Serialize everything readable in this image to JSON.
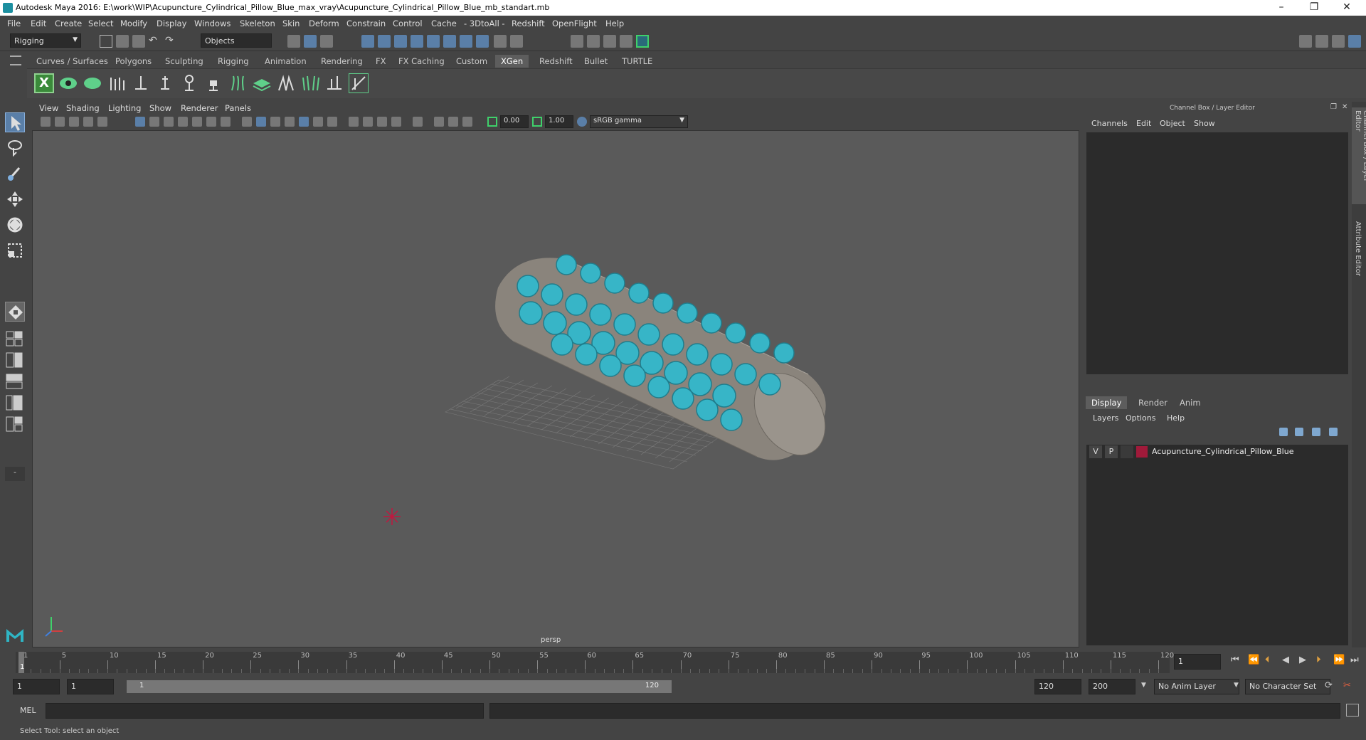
{
  "window": {
    "title": "Autodesk Maya 2016: E:\\work\\WIP\\Acupuncture_Cylindrical_Pillow_Blue_max_vray\\Acupuncture_Cylindrical_Pillow_Blue_mb_standart.mb",
    "minimize": "–",
    "restore": "❐",
    "close": "✕"
  },
  "menubar": [
    "File",
    "Edit",
    "Create",
    "Select",
    "Modify",
    "Display",
    "Windows",
    "Skeleton",
    "Skin",
    "Deform",
    "Constrain",
    "Control",
    "Cache",
    "- 3DtoAll -",
    "Redshift",
    "OpenFlight",
    "Help"
  ],
  "statusline": {
    "mode": "Rigging",
    "selection_mode": "Objects"
  },
  "shelf_tabs": [
    "Curves / Surfaces",
    "Polygons",
    "Sculpting",
    "Rigging",
    "Animation",
    "Rendering",
    "FX",
    "FX Caching",
    "Custom",
    "XGen",
    "Redshift",
    "Bullet",
    "TURTLE"
  ],
  "active_shelf_tab": "XGen",
  "panel_menu": [
    "View",
    "Shading",
    "Lighting",
    "Show",
    "Renderer",
    "Panels"
  ],
  "panel_toolbar": {
    "exposure": "0.00",
    "gamma": "1.00",
    "colorspace": "sRGB gamma"
  },
  "viewport": {
    "camera_label": "persp"
  },
  "channel_box": {
    "title": "Channel Box / Layer Editor",
    "menus": [
      "Channels",
      "Edit",
      "Object",
      "Show"
    ]
  },
  "layer_editor": {
    "tabs": [
      "Display",
      "Render",
      "Anim"
    ],
    "active_tab": "Display",
    "menus": [
      "Layers",
      "Options",
      "Help"
    ],
    "layers": [
      {
        "v": "V",
        "p": "P",
        "name": "Acupuncture_Cylindrical_Pillow_Blue",
        "color": "#a01a3a"
      }
    ]
  },
  "side_tabs": [
    "Channel Box / Layer Editor",
    "Attribute Editor"
  ],
  "timeline": {
    "ticks": [
      "1",
      "5",
      "10",
      "15",
      "20",
      "25",
      "30",
      "35",
      "40",
      "45",
      "50",
      "55",
      "60",
      "65",
      "70",
      "75",
      "80",
      "85",
      "90",
      "95",
      "100",
      "105",
      "110",
      "115",
      "120"
    ],
    "current_frame": "1"
  },
  "range": {
    "start": "1",
    "anim_start": "1",
    "range_slider_start": "1",
    "range_slider_end": "120",
    "anim_end_field": "120",
    "end": "200",
    "anim_layer": "No Anim Layer",
    "char_set": "No Character Set"
  },
  "cmdline": {
    "label": "MEL"
  },
  "helpline": {
    "text": "Select Tool: select an object"
  },
  "colors": {
    "accent_tab": "#5d5d5d",
    "pillow_spike": "#37b5c7",
    "pillow_body": "#8a847c"
  }
}
